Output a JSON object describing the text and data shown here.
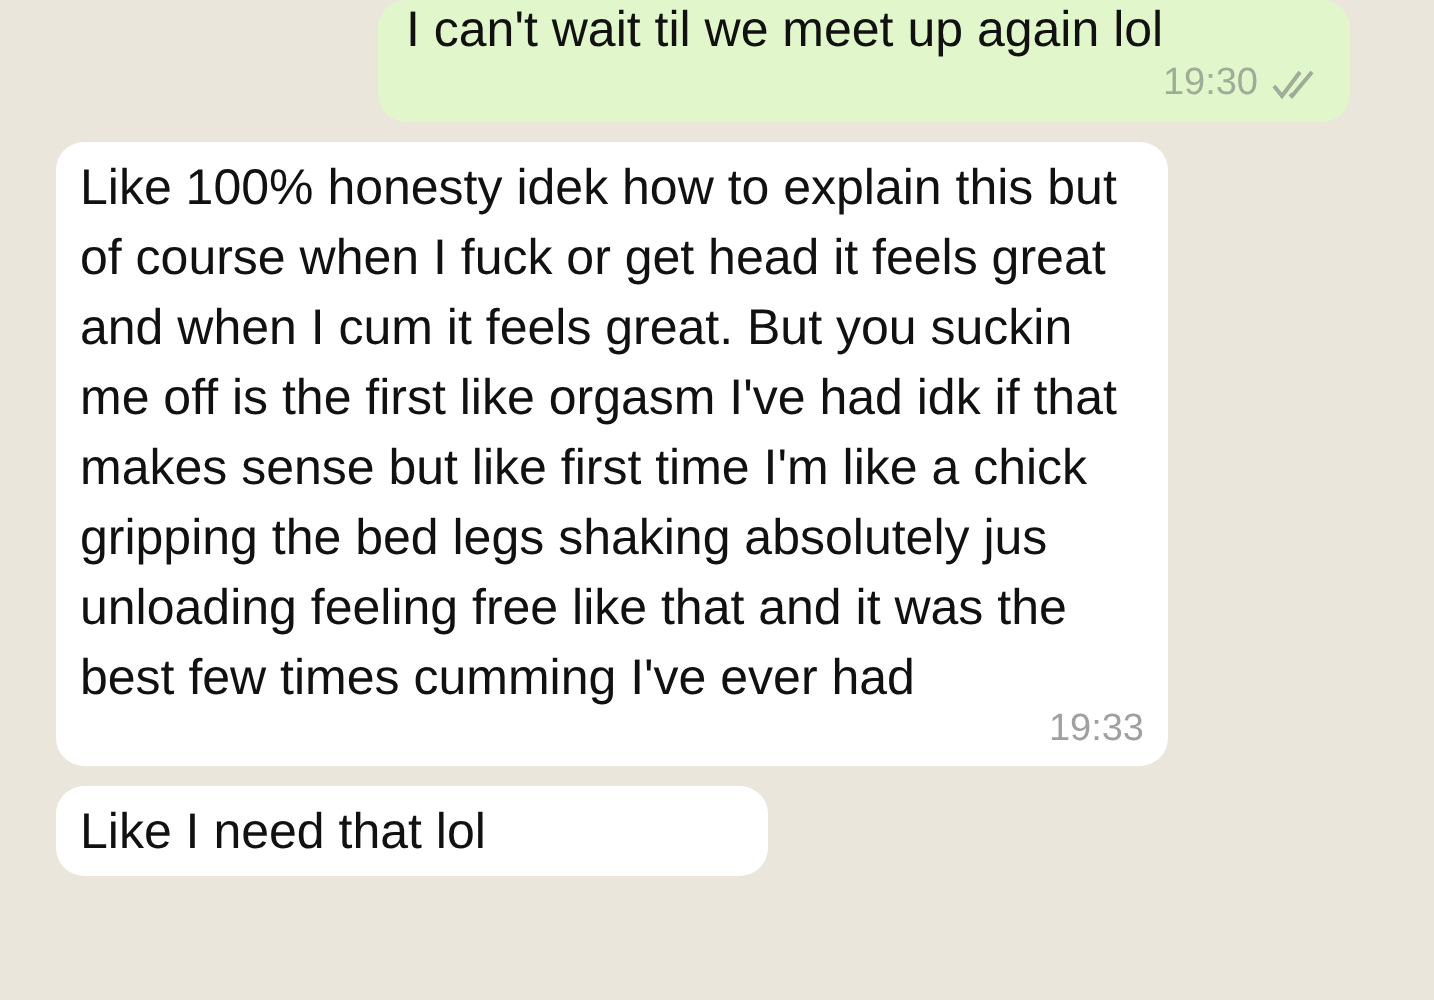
{
  "messages": [
    {
      "kind": "sent",
      "text": "I can't wait til we meet up again lol",
      "time": "19:30",
      "read": false
    },
    {
      "kind": "received",
      "text": "Like 100% honesty idek how to explain this but of course when I fuck or get head it feels great and when I cum it feels great. But you suckin me off is the first like orgasm I've had idk if that makes sense but like first time I'm like a chick gripping the bed legs shaking absolutely jus unloading feeling free like that and it was the best few times cumming I've ever had",
      "time": "19:33"
    },
    {
      "kind": "received",
      "text": "Like I need that lol"
    }
  ]
}
